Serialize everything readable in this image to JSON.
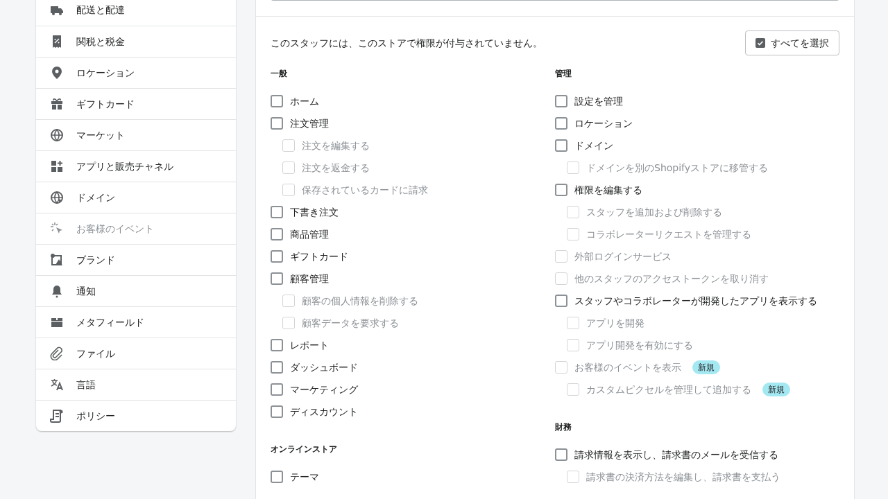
{
  "sidebar": {
    "items": [
      {
        "label": "配送と配達",
        "disabled": false
      },
      {
        "label": "関税と税金",
        "disabled": false
      },
      {
        "label": "ロケーション",
        "disabled": false
      },
      {
        "label": "ギフトカード",
        "disabled": false
      },
      {
        "label": "マーケット",
        "disabled": false
      },
      {
        "label": "アプリと販売チャネル",
        "disabled": false
      },
      {
        "label": "ドメイン",
        "disabled": false
      },
      {
        "label": "お客様のイベント",
        "disabled": true
      },
      {
        "label": "ブランド",
        "disabled": false
      },
      {
        "label": "通知",
        "disabled": false
      },
      {
        "label": "メタフィールド",
        "disabled": false
      },
      {
        "label": "ファイル",
        "disabled": false
      },
      {
        "label": "言語",
        "disabled": false
      },
      {
        "label": "ポリシー",
        "disabled": false
      }
    ]
  },
  "permissions": {
    "message": "このスタッフには、このストアで権限が付与されていません。",
    "select_all_button": "すべてを選択",
    "columns": [
      {
        "sections": [
          {
            "heading": "一般",
            "items": [
              {
                "label": "ホーム",
                "checked": false,
                "disabled": false
              },
              {
                "label": "注文管理",
                "checked": false,
                "disabled": false,
                "children": [
                  {
                    "label": "注文を編集する",
                    "checked": false,
                    "disabled": true
                  },
                  {
                    "label": "注文を返金する",
                    "checked": false,
                    "disabled": true
                  },
                  {
                    "label": "保存されているカードに請求",
                    "checked": false,
                    "disabled": true
                  }
                ]
              },
              {
                "label": "下書き注文",
                "checked": false,
                "disabled": false
              },
              {
                "label": "商品管理",
                "checked": false,
                "disabled": false
              },
              {
                "label": "ギフトカード",
                "checked": false,
                "disabled": false
              },
              {
                "label": "顧客管理",
                "checked": false,
                "disabled": false,
                "children": [
                  {
                    "label": "顧客の個人情報を削除する",
                    "checked": false,
                    "disabled": true
                  },
                  {
                    "label": "顧客データを要求する",
                    "checked": false,
                    "disabled": true
                  }
                ]
              },
              {
                "label": "レポート",
                "checked": false,
                "disabled": false
              },
              {
                "label": "ダッシュボード",
                "checked": false,
                "disabled": false
              },
              {
                "label": "マーケティング",
                "checked": false,
                "disabled": false
              },
              {
                "label": "ディスカウント",
                "checked": false,
                "disabled": false
              }
            ]
          },
          {
            "heading": "オンラインストア",
            "items": [
              {
                "label": "テーマ",
                "checked": false,
                "disabled": false
              }
            ]
          }
        ]
      },
      {
        "sections": [
          {
            "heading": "管理",
            "items": [
              {
                "label": "設定を管理",
                "checked": false,
                "disabled": false
              },
              {
                "label": "ロケーション",
                "checked": false,
                "disabled": false
              },
              {
                "label": "ドメイン",
                "checked": false,
                "disabled": false,
                "children": [
                  {
                    "label": "ドメインを別のShopifyストアに移管する",
                    "checked": false,
                    "disabled": true
                  }
                ]
              },
              {
                "label": "権限を編集する",
                "checked": false,
                "disabled": false,
                "children": [
                  {
                    "label": "スタッフを追加および削除する",
                    "checked": false,
                    "disabled": true
                  },
                  {
                    "label": "コラボレーターリクエストを管理する",
                    "checked": false,
                    "disabled": true
                  }
                ]
              },
              {
                "label": "外部ログインサービス",
                "checked": false,
                "disabled": true
              },
              {
                "label": "他のスタッフのアクセストークンを取り消す",
                "checked": false,
                "disabled": true
              },
              {
                "label": "スタッフやコラボレーターが開発したアプリを表示する",
                "checked": false,
                "disabled": false,
                "children": [
                  {
                    "label": "アプリを開発",
                    "checked": false,
                    "disabled": true
                  },
                  {
                    "label": "アプリ開発を有効にする",
                    "checked": false,
                    "disabled": true
                  }
                ]
              },
              {
                "label": "お客様のイベントを表示",
                "checked": false,
                "disabled": true,
                "badge": "新規",
                "children": [
                  {
                    "label": "カスタムピクセルを管理して追加する",
                    "checked": false,
                    "disabled": true,
                    "badge": "新規"
                  }
                ]
              }
            ]
          },
          {
            "heading": "財務",
            "items": [
              {
                "label": "請求情報を表示し、請求書のメールを受信する",
                "checked": false,
                "disabled": false,
                "children": [
                  {
                    "label": "請求書の決済方法を編集し、請求書を支払う",
                    "checked": false,
                    "disabled": true
                  }
                ]
              }
            ]
          }
        ]
      }
    ]
  }
}
